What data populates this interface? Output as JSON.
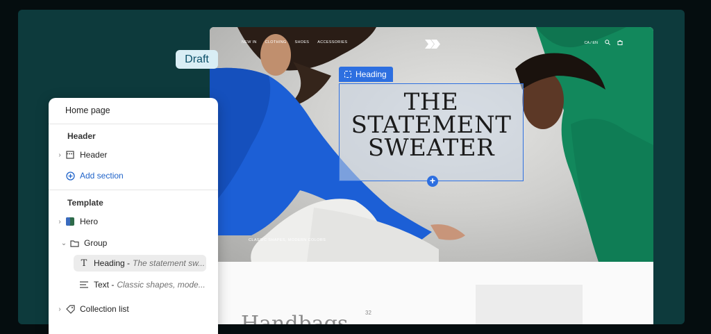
{
  "badge": {
    "label": "Draft"
  },
  "storefront": {
    "nav": [
      "NEW IN",
      "CLOTHING",
      "SHOES",
      "ACCESSORIES"
    ],
    "locale": "CA / EN",
    "icons": [
      "search-icon",
      "cart-icon"
    ],
    "heading_tag": "Heading",
    "heading_lines": [
      "THE",
      "STATEMENT",
      "SWEATER"
    ],
    "subheading": "CLASSIC SHAPES, MODERN COLORS",
    "collection_title": "Handbags",
    "collection_count": "32",
    "colors": {
      "selection": "#2d6fe0",
      "blue_sweater": "#1c5fd6",
      "green_sweater": "#12885c"
    }
  },
  "panel": {
    "page_title": "Home page",
    "header_section": "Header",
    "header_item": "Header",
    "add_section": "Add section",
    "template_section": "Template",
    "hero": "Hero",
    "group": "Group",
    "heading_label": "Heading -",
    "heading_preview": "The statement sw...",
    "text_label": "Text -",
    "text_preview": "Classic shapes, mode...",
    "collection_list": "Collection list"
  }
}
